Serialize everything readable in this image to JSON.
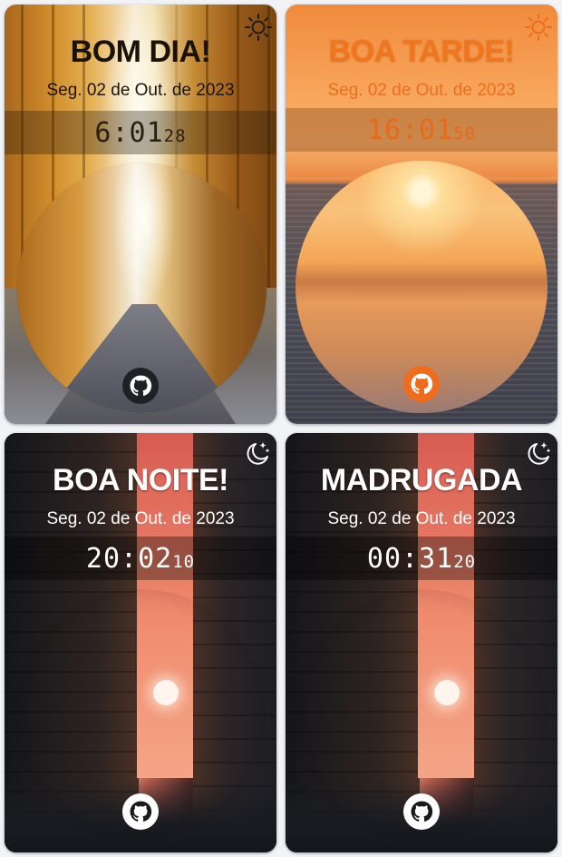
{
  "cards": [
    {
      "id": "morning",
      "greeting": "BOM DIA!",
      "date": "Seg. 02 de Out. de 2023",
      "time_main": "6:01",
      "time_seconds": "28",
      "theme_icon": "sun-icon",
      "github_icon": "github-icon",
      "colors": {
        "text": "#1a1208",
        "accent": "#2b2014"
      }
    },
    {
      "id": "afternoon",
      "greeting": "BOA TARDE!",
      "date": "Seg. 02 de Out. de 2023",
      "time_main": "16:01",
      "time_seconds": "50",
      "theme_icon": "sun-icon",
      "github_icon": "github-icon",
      "colors": {
        "text": "#f1751d",
        "accent": "#e56b1b"
      }
    },
    {
      "id": "night",
      "greeting": "BOA NOITE!",
      "date": "Seg. 02 de Out. de 2023",
      "time_main": "20:02",
      "time_seconds": "10",
      "theme_icon": "moon-stars-icon",
      "github_icon": "github-icon",
      "colors": {
        "text": "#ffffff",
        "accent": "#ffffff"
      }
    },
    {
      "id": "dawn",
      "greeting": "MADRUGADA",
      "date": "Seg. 02 de Out. de 2023",
      "time_main": "00:31",
      "time_seconds": "20",
      "theme_icon": "moon-stars-icon",
      "github_icon": "github-icon",
      "colors": {
        "text": "#ffffff",
        "accent": "#ffffff"
      }
    }
  ]
}
